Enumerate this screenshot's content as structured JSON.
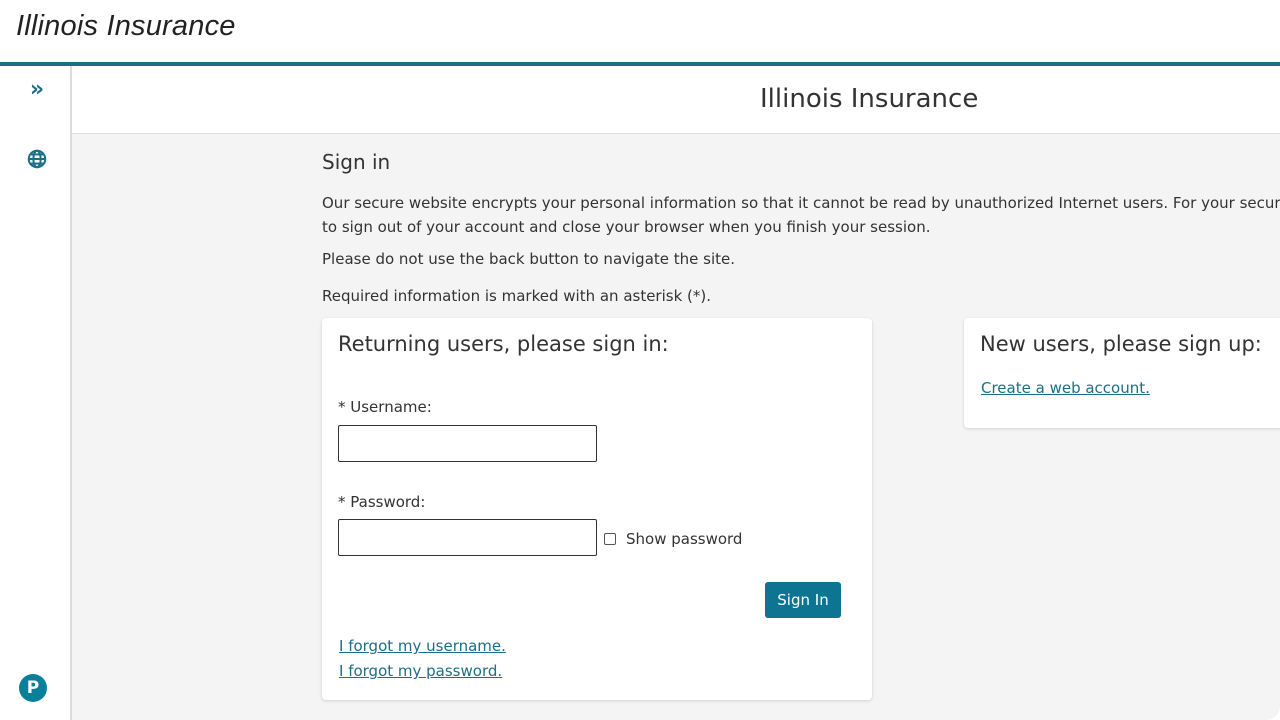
{
  "app": {
    "brand_title": "Illinois Insurance"
  },
  "rail": {
    "expand_icon": "double-chevron-right-icon",
    "globe_icon": "globe-icon",
    "logo_letter": "P",
    "logo_icon": "pearson-logo-icon"
  },
  "header": {
    "title": "Illinois Insurance"
  },
  "signin": {
    "heading": "Sign in",
    "para1_line1": "Our secure website encrypts your personal information so that it cannot be read by unauthorized Internet users. For your security",
    "para1_line2": "to sign out of your account and close your browser when you finish your session.",
    "para2": "Please do not use the back button to navigate the site.",
    "para3": "Required information is marked with an asterisk (*)."
  },
  "login_card": {
    "title": "Returning users, please sign in:",
    "username_label": "* Username:",
    "username_value": "",
    "password_label": "* Password:",
    "password_value": "",
    "show_password_label": "Show password",
    "show_password_checked": false,
    "signin_button": "Sign In",
    "forgot_username": "I forgot my username.",
    "forgot_password": "I forgot my password."
  },
  "signup_card": {
    "title": "New users, please sign up:",
    "create_link": "Create a web account."
  },
  "colors": {
    "accent": "#0d7591",
    "rule": "#1b6f86",
    "link": "#1b6f86",
    "background": "#f4f4f4"
  }
}
